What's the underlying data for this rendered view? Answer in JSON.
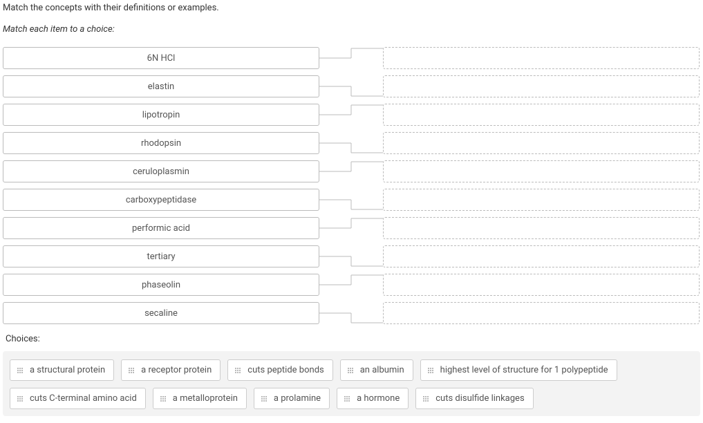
{
  "instructions": "Match the concepts with their definitions or examples.",
  "sub_instructions": "Match each item to a choice:",
  "concepts": [
    "6N HCl",
    "elastin",
    "lipotropin",
    "rhodopsin",
    "ceruloplasmin",
    "carboxypeptidase",
    "performic acid",
    "tertiary",
    "phaseolin",
    "secaline"
  ],
  "choices_label": "Choices:",
  "choices": [
    "a structural protein",
    "a receptor protein",
    "cuts peptide bonds",
    "an albumin",
    "highest level of structure for 1 polypeptide",
    "cuts C-terminal amino acid",
    "a metalloprotein",
    "a prolamine",
    "a hormone",
    "cuts disulfide linkages"
  ]
}
